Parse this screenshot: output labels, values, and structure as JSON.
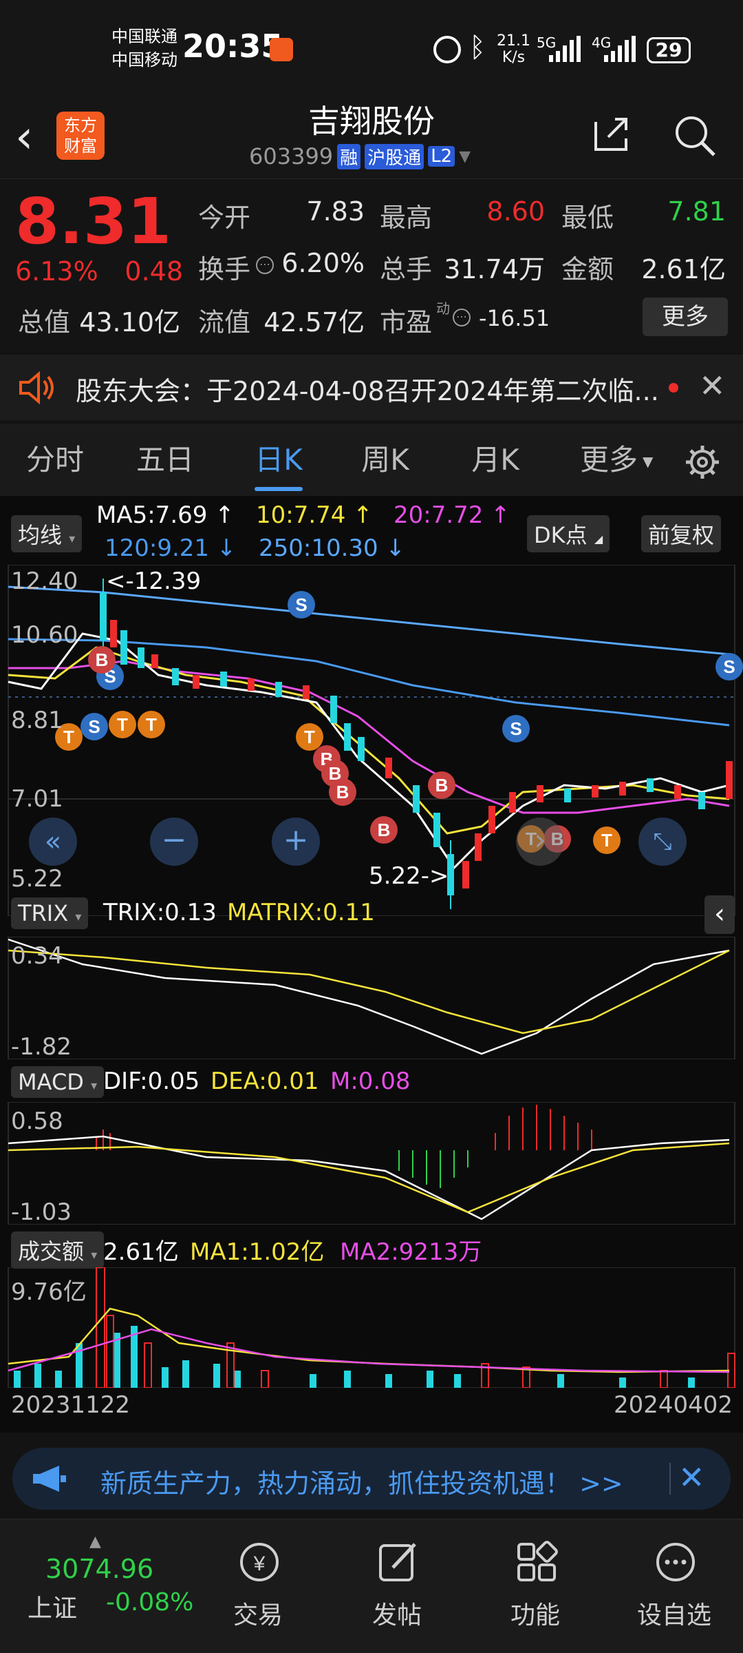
{
  "status": {
    "carrier1": "中国联通",
    "carrier2": "中国移动",
    "time": "20:35",
    "speed_value": "21.1",
    "speed_unit": "K/s",
    "net1": "5G",
    "net2": "4G",
    "battery": "29"
  },
  "header": {
    "logo_line1": "东方",
    "logo_line2": "财富",
    "title": "吉翔股份",
    "code": "603399",
    "badge1": "融",
    "badge2": "沪股通",
    "badge3": "L2"
  },
  "quote": {
    "price": "8.31",
    "change_pct": "6.13%",
    "change": "0.48",
    "open_label": "今开",
    "open": "7.83",
    "high_label": "最高",
    "high": "8.60",
    "low_label": "最低",
    "low": "7.81",
    "turnover_label": "换手",
    "turnover": "6.20%",
    "volume_label": "总手",
    "volume": "31.74万",
    "amount_label": "金额",
    "amount": "2.61亿",
    "mktcap_label": "总值",
    "mktcap": "43.10亿",
    "float_label": "流值",
    "float": "42.57亿",
    "pe_label": "市盈",
    "pe_sup": "动",
    "pe": "-16.51",
    "more_button": "更多"
  },
  "notice": {
    "text": "股东大会：于2024-04-08召开2024年第二次临..."
  },
  "tabs": [
    "分时",
    "五日",
    "日K",
    "周K",
    "月K",
    "更多"
  ],
  "active_tab": 2,
  "chart": {
    "ma_selector": "均线",
    "ma5": "MA5:7.69 ↑",
    "ma10": "10:7.74 ↑",
    "ma20": "20:7.72 ↑",
    "ma120": "120:9.21 ↓",
    "ma250": "250:10.30 ↓",
    "dk_button": "DK点",
    "adjust_button": "前复权",
    "price_ticks": [
      "12.40",
      "10.60",
      "8.81",
      "7.01",
      "5.22"
    ],
    "high_marker": "<-12.39",
    "low_marker": "5.22->",
    "trix_selector": "TRIX",
    "trix_value": "TRIX:0.13",
    "matrix_value": "MATRIX:0.11",
    "trix_ticks": [
      "0.34",
      "-1.82"
    ],
    "macd_selector": "MACD",
    "dif": "DIF:0.05",
    "dea": "DEA:0.01",
    "m": "M:0.08",
    "macd_ticks": [
      "0.58",
      "-1.03"
    ],
    "vol_selector": "成交额",
    "vol_value": "2.61亿",
    "vol_ma1": "MA1:1.02亿",
    "vol_ma2": "MA2:9213万",
    "vol_tick": "9.76亿",
    "date_start": "20231122",
    "date_end": "20240402",
    "colors": {
      "up": "#ef2b2b",
      "down": "#25d6e0",
      "ma5": "#ffffff",
      "ma10": "#f5e33b",
      "ma20": "#e64ee6",
      "ma120": "#4a9af0",
      "ma250": "#5aa8ff"
    }
  },
  "banner": {
    "text": "新质生产力，热力涌动，抓住投资机遇！ >>"
  },
  "bottom": {
    "index_value": "3074.96",
    "index_name": "上证",
    "index_change": "-0.08%",
    "nav": [
      "交易",
      "发帖",
      "功能",
      "设自选"
    ]
  }
}
